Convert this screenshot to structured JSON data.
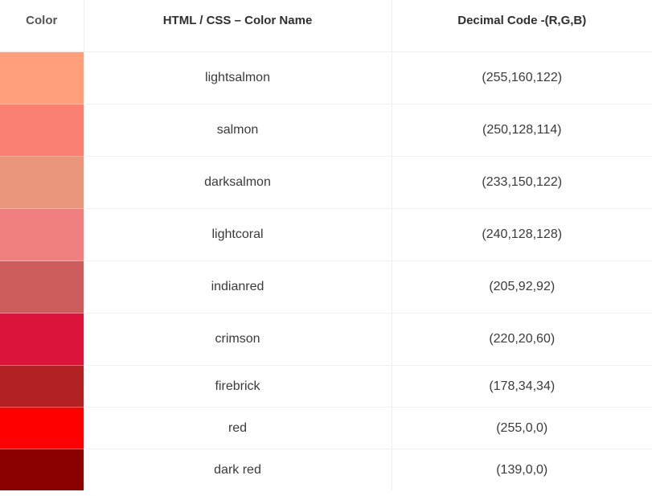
{
  "table": {
    "headers": {
      "color": "Color",
      "name": "HTML / CSS – Color Name",
      "code": "Decimal Code -(R,G,B)"
    },
    "rows": [
      {
        "swatch": "#FFA07A",
        "name": "lightsalmon",
        "code": "(255,160,122)"
      },
      {
        "swatch": "#FA8072",
        "name": "salmon",
        "code": "(250,128,114)"
      },
      {
        "swatch": "#E9967A",
        "name": "darksalmon",
        "code": "(233,150,122)"
      },
      {
        "swatch": "#F08080",
        "name": "lightcoral",
        "code": "(240,128,128)"
      },
      {
        "swatch": "#CD5C5C",
        "name": "indianred",
        "code": "(205,92,92)"
      },
      {
        "swatch": "#DC143C",
        "name": "crimson",
        "code": "(220,20,60)"
      },
      {
        "swatch": "#B22222",
        "name": "firebrick",
        "code": "(178,34,34)"
      },
      {
        "swatch": "#FF0000",
        "name": "red",
        "code": "(255,0,0)"
      },
      {
        "swatch": "#8B0000",
        "name": "dark red",
        "code": "(139,0,0)"
      }
    ]
  }
}
